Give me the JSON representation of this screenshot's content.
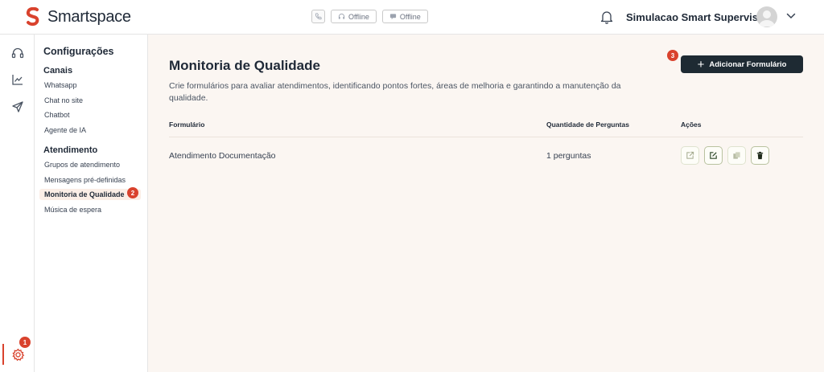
{
  "app": {
    "name": "Smartspace"
  },
  "header": {
    "status_1": "Offline",
    "status_2": "Offline",
    "user_name": "Simulacao Smart Supervisor"
  },
  "sidebar": {
    "title": "Configurações",
    "sections": [
      {
        "label": "Canais",
        "items": [
          "Whatsapp",
          "Chat no site",
          "Chatbot",
          "Agente de IA"
        ]
      },
      {
        "label": "Atendimento",
        "items": [
          "Grupos de atendimento",
          "Mensagens pré-definidas",
          "Monitoria de Qualidade",
          "Música de espera"
        ]
      }
    ],
    "active_item": "Monitoria de Qualidade"
  },
  "badges": {
    "settings": "1",
    "menu": "2",
    "add": "3"
  },
  "main": {
    "title": "Monitoria de Qualidade",
    "description": "Crie formulários para avaliar atendimentos, identificando pontos fortes, áreas de melhoria e garantindo a manutenção da qualidade.",
    "add_button": "Adicionar Formulário",
    "table": {
      "headers": [
        "Formulário",
        "Quantidade de Perguntas",
        "Ações"
      ],
      "rows": [
        {
          "form": "Atendimento Documentação",
          "questions": "1 perguntas"
        }
      ]
    }
  },
  "colors": {
    "brand": "#d9422d",
    "dark_button": "#1e2a33",
    "main_bg": "#fbf6f2",
    "active_bg": "#fbeee6"
  },
  "icons": [
    "phone-icon",
    "headset-icon",
    "chat-icon",
    "bell-icon",
    "chevron-down-icon",
    "chart-icon",
    "send-icon",
    "gear-icon",
    "external-link-icon",
    "edit-icon",
    "copy-icon",
    "trash-icon"
  ]
}
